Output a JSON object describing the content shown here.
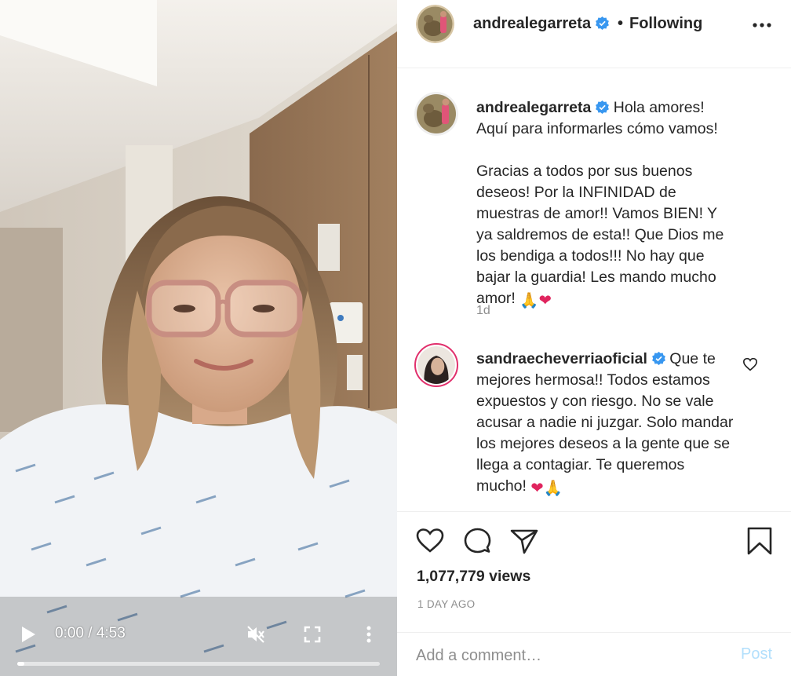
{
  "video": {
    "current_time": "0:00",
    "separator": "/",
    "duration": "4:53",
    "progress_fraction": 0.02,
    "icons": {
      "play": "play-icon",
      "mute": "muted-speaker-icon",
      "fullscreen": "fullscreen-icon",
      "more": "vertical-dots-icon"
    }
  },
  "header": {
    "username": "andrealegarreta",
    "dot": "•",
    "follow_status": "Following"
  },
  "caption": {
    "username": "andrealegarreta",
    "lines": [
      "Hola amores! Aquí para informarles cómo vamos!",
      "Gracias a todos por sus buenos deseos! Por la INFINIDAD de muestras de amor!! Vamos BIEN! Y ya saldremos de esta!! Que Dios me los bendiga a todos!!! No hay que bajar la guardia! Les mando mucho amor!"
    ],
    "emojis": [
      "🙏",
      "❤"
    ],
    "time": "1d"
  },
  "comments": [
    {
      "username": "sandraecheverriaoficial",
      "text": "Que te mejores hermosa!! Todos estamos expuestos y con riesgo. No se vale acusar a nadie ni juzgar. Solo mandar los mejores deseos a la gente que se llega a contagiar. Te queremos mucho!",
      "emojis": [
        "❤",
        "🙏"
      ]
    }
  ],
  "actions": {
    "views": "1,077,779 views",
    "posted": "1 DAY AGO",
    "comment_placeholder": "Add a comment…",
    "post_label": "Post"
  },
  "colors": {
    "verified": "#3897f0",
    "post_disabled": "#b2dffc",
    "muted_text": "#8e8e8e",
    "heart_red": "#e0245e"
  }
}
